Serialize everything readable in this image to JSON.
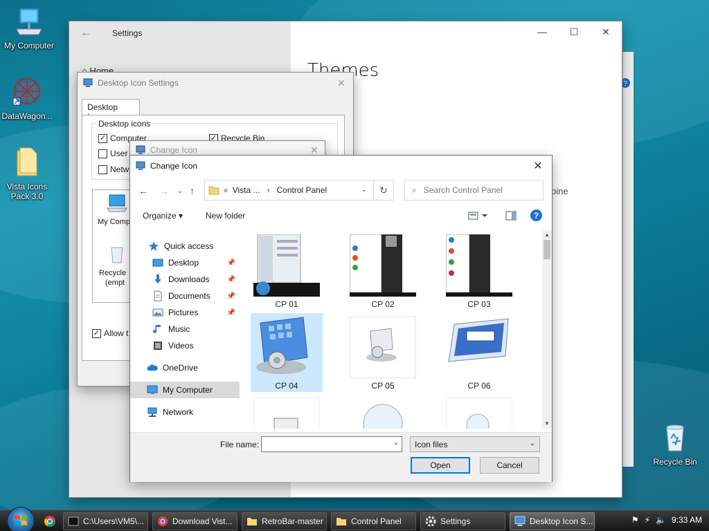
{
  "desktop": {
    "icons": [
      {
        "label": "My Computer"
      },
      {
        "label": "DataWagon..."
      },
      {
        "label": "Vista Icons\nPack 3.0"
      },
      {
        "label": "Recycle Bin"
      }
    ]
  },
  "settings": {
    "title": "Settings",
    "home": "Home",
    "page_title": "Themes",
    "partial_text": "bine"
  },
  "desktop_icon_settings": {
    "title": "Desktop Icon Settings",
    "tab": "Desktop Icons",
    "group_label": "Desktop icons",
    "checkboxes": [
      {
        "label": "Computer",
        "checked": true
      },
      {
        "label": "User",
        "checked": false
      },
      {
        "label": "Netw",
        "checked": false
      },
      {
        "label": "Recycle Bin",
        "checked": true
      }
    ],
    "preview_items": [
      "My Comp",
      "Recycle",
      "(empt"
    ],
    "allow_label": "Allow t"
  },
  "change_icon_small": {
    "title": "Change Icon"
  },
  "change_icon": {
    "title": "Change Icon",
    "address": {
      "prefix": "«",
      "crumb1": "Vista ...",
      "sep": "›",
      "crumb2": "Control Panel"
    },
    "search_placeholder": "Search Control Panel",
    "commands": {
      "organize": "Organize ▾",
      "new_folder": "New folder"
    },
    "nav": [
      {
        "label": "Quick access",
        "pinned": false
      },
      {
        "label": "Desktop",
        "pinned": true
      },
      {
        "label": "Downloads",
        "pinned": true
      },
      {
        "label": "Documents",
        "pinned": true
      },
      {
        "label": "Pictures",
        "pinned": true
      },
      {
        "label": "Music",
        "pinned": false
      },
      {
        "label": "Videos",
        "pinned": false
      },
      {
        "label": "OneDrive",
        "pinned": false
      },
      {
        "label": "My Computer",
        "pinned": false,
        "selected": true
      },
      {
        "label": "Network",
        "pinned": false
      }
    ],
    "files": [
      {
        "label": "CP 01"
      },
      {
        "label": "CP 02"
      },
      {
        "label": "CP 03"
      },
      {
        "label": "CP 04",
        "selected": true
      },
      {
        "label": "CP 05"
      },
      {
        "label": "CP 06"
      },
      {
        "label": ""
      },
      {
        "label": ""
      },
      {
        "label": ""
      }
    ],
    "file_name_label": "File name:",
    "file_name_value": "",
    "file_type": "Icon files",
    "open_label": "Open",
    "cancel_label": "Cancel"
  },
  "taskbar": {
    "buttons": [
      {
        "label": "C:\\Users\\VM5\\..."
      },
      {
        "label": "Download Vist..."
      },
      {
        "label": "RetroBar-master"
      },
      {
        "label": "Control Panel"
      },
      {
        "label": "Settings"
      },
      {
        "label": "Desktop Icon S..."
      }
    ],
    "clock": "9:33 AM"
  },
  "colors": {
    "accent": "#0078d7",
    "selection": "#cce8ff",
    "help": "#1e6fd0"
  }
}
